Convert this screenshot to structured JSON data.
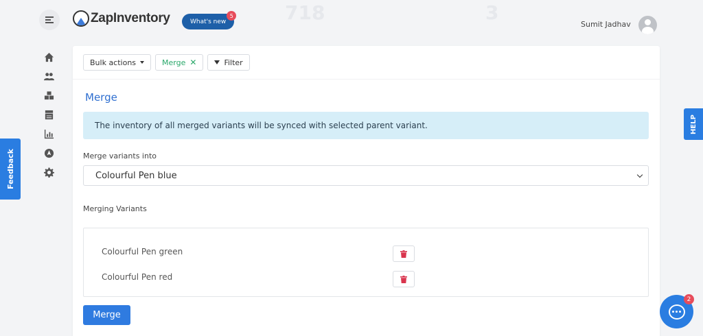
{
  "header": {
    "brand": "ZapInventory",
    "whats_new": {
      "label": "What's new",
      "count": "5"
    },
    "user_name": "Sumit Jadhav"
  },
  "background_stats": [
    "718",
    "3"
  ],
  "sidebar": {
    "icons": [
      "home-icon",
      "users-icon",
      "boxes-icon",
      "warehouse-icon",
      "chart-icon",
      "compass-icon",
      "gear-icon"
    ]
  },
  "toolbar": {
    "bulk_actions_label": "Bulk actions",
    "merge_label": "Merge",
    "filter_label": "Filter"
  },
  "merge": {
    "title": "Merge",
    "info_message": "The inventory of all merged variants will be synced with selected parent variant.",
    "merge_into_label": "Merge variants into",
    "merge_into_value": "Colourful Pen blue",
    "merging_variants_label": "Merging Variants",
    "variants": [
      {
        "name": "Colourful Pen green"
      },
      {
        "name": "Colourful Pen red"
      }
    ],
    "submit_label": "Merge"
  },
  "side_tabs": {
    "feedback": "Feedback",
    "help": "HELP"
  },
  "chat": {
    "unread": "2"
  },
  "colors": {
    "primary": "#2f7be0",
    "accent_green": "#2aa86a",
    "alert_bg": "#d6eef8",
    "danger": "#d9354e"
  }
}
